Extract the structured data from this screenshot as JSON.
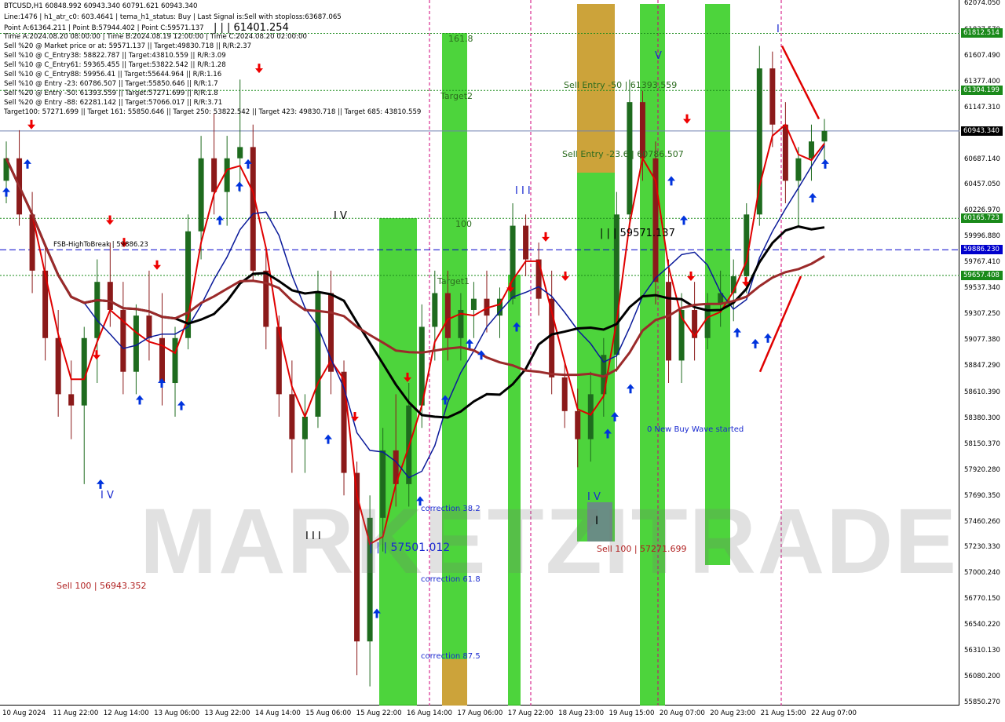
{
  "header": {
    "lines": [
      "BTCUSD,H1  60848.992 60943.340 60791.621 60943.340",
      "Line:1476  |  h1_atr_c0: 603.4641  |  tema_h1_status: Buy  |  Last Signal is:Sell with stoploss:63687.065",
      "Point A:61364.211  |  Point B:57944.402  |  Point C:59571.137",
      "Time A:2024.08.20 08:00:00  |  Time B:2024.08.19 12:00:00  |  Time C:2024.08.20 02:00:00",
      "Sell %20 @ Market price or at: 59571.137  ||  Target:49830.718  ||  R/R:2.37",
      "Sell %10 @ C_Entry38: 58822.787  ||  Target:43810.559  ||  R/R:3.09",
      "Sell %10 @ C_Entry61: 59365.455  ||  Target:53822.542  ||  R/R:1.28",
      "Sell %10 @ C_Entry88: 59956.41  ||  Target:55644.964  ||  R/R:1.16",
      "Sell %10 @ Entry -23: 60786.507  ||  Target:55850.646  ||  R/R:1.7",
      "Sell %20 @ Entry -50: 61393.559  ||  Target:57271.699  ||  R/R:1.8",
      "Sell %20 @ Entry -88: 62281.142  ||  Target:57066.017  ||  R/R:3.71",
      "Target100: 57271.699  ||  Target 161: 55850.646  ||  Target 250: 53822.542  ||  Target 423: 49830.718  ||  Target 685: 43810.559"
    ]
  },
  "colors": {
    "bull_candle": "#1e6b1e",
    "bear_candle": "#8b1a1a",
    "ma_red": "#e00000",
    "ma_blue": "#0a1a9a",
    "ma_black": "#000000",
    "ma_maroon": "#9b2a2a",
    "zone_green": "#2ecc1a",
    "zone_orange": "#e39a3a",
    "zone_gray": "#6f8090",
    "level_green": "#1a8a1a",
    "level_blue": "#0000cc",
    "current_price_line": "#7080b0",
    "buy_arrow": "#0033dd",
    "sell_arrow": "#ee0000"
  },
  "price_axis": {
    "ticks": [
      "62074.050",
      "61837.570",
      "61607.490",
      "61377.400",
      "61147.310",
      "60917.230",
      "60687.140",
      "60457.050",
      "60226.970",
      "59996.880",
      "59767.410",
      "59537.340",
      "59307.250",
      "59077.380",
      "58847.290",
      "58610.390",
      "58380.300",
      "58150.370",
      "57920.280",
      "57690.350",
      "57460.260",
      "57230.330",
      "57000.240",
      "56770.150",
      "56540.220",
      "56310.130",
      "56080.200",
      "55850.270"
    ],
    "badges": [
      {
        "text": "61812.514",
        "price": 61812.514,
        "color": "#1a8a1a"
      },
      {
        "text": "61304.199",
        "price": 61304.199,
        "color": "#1a8a1a"
      },
      {
        "text": "60943.340",
        "price": 60943.34,
        "color": "#000000"
      },
      {
        "text": "60165.723",
        "price": 60165.723,
        "color": "#1a8a1a"
      },
      {
        "text": "59886.230",
        "price": 59886.23,
        "color": "#0000cc"
      },
      {
        "text": "59657.408",
        "price": 59657.408,
        "color": "#1a8a1a"
      }
    ]
  },
  "time_axis": {
    "ticks": [
      "10 Aug 2024",
      "11 Aug 22:00",
      "12 Aug 14:00",
      "13 Aug 06:00",
      "13 Aug 22:00",
      "14 Aug 14:00",
      "15 Aug 06:00",
      "15 Aug 22:00",
      "16 Aug 14:00",
      "17 Aug 06:00",
      "17 Aug 22:00",
      "18 Aug 23:00",
      "19 Aug 15:00",
      "20 Aug 07:00",
      "20 Aug 23:00",
      "21 Aug 15:00",
      "22 Aug 07:00"
    ]
  },
  "annotations": {
    "price_label_1": "| | | 61401.254",
    "price_label_2": "| | | 59571.137",
    "price_label_3": "| | | 57501.012",
    "sell_entry_50": "Sell Entry -50 | 61393.559",
    "sell_entry_23": "Sell Entry -23.6 | 60786.507",
    "sell_100_right": "Sell 100 | 57271.699",
    "sell_100_left": "Sell 100 | 56943.352",
    "fsb_label": "FSB-HighToBreak | 59886.23",
    "fib_161": "161.8",
    "fib_target2": "Target2",
    "fib_100": "100",
    "fib_target1": "Target1",
    "correction_38": "correction 38.2",
    "correction_61": "correction 61.8",
    "correction_87": "correction 87.5",
    "new_wave": "0 New Buy Wave started",
    "wave_iv_1": "I V",
    "wave_iv_2": "I V",
    "wave_iv_3": "I V",
    "wave_iii_1": "I I I",
    "wave_iii_2": "I I I",
    "wave_v": "V",
    "wave_i_1": "I",
    "wave_i_2": "I",
    "watermark": "MARKETZITRADE"
  },
  "chart_data": {
    "type": "candlestick",
    "symbol": "BTCUSD,H1",
    "ylim": [
      55850.27,
      62074.05
    ],
    "series_note": "Candles estimated from chart image, approx. 66 hourly bars sampled across the visible range",
    "candles": [
      [
        60500,
        60850,
        60300,
        60700
      ],
      [
        60700,
        60950,
        60100,
        60200
      ],
      [
        60200,
        60400,
        59500,
        59700
      ],
      [
        59700,
        59900,
        58900,
        59100
      ],
      [
        59100,
        59350,
        58400,
        58600
      ],
      [
        58600,
        58900,
        58200,
        58500
      ],
      [
        58500,
        59200,
        57800,
        59100
      ],
      [
        59100,
        59800,
        58700,
        59600
      ],
      [
        59600,
        59950,
        59200,
        59350
      ],
      [
        59350,
        59600,
        58600,
        58800
      ],
      [
        58800,
        59400,
        58600,
        59300
      ],
      [
        59300,
        59700,
        58900,
        59100
      ],
      [
        59100,
        59500,
        58500,
        58700
      ],
      [
        58700,
        59200,
        58400,
        59100
      ],
      [
        59100,
        60200,
        59000,
        60050
      ],
      [
        60050,
        60900,
        59800,
        60700
      ],
      [
        60700,
        61100,
        60200,
        60400
      ],
      [
        60400,
        60900,
        60100,
        60700
      ],
      [
        60700,
        61401,
        60400,
        60800
      ],
      [
        60800,
        61000,
        59600,
        59700
      ],
      [
        59700,
        59900,
        59000,
        59200
      ],
      [
        59200,
        59300,
        58400,
        58600
      ],
      [
        58600,
        58900,
        57900,
        58200
      ],
      [
        58200,
        58600,
        57900,
        58400
      ],
      [
        58400,
        59700,
        58300,
        59500
      ],
      [
        59500,
        59700,
        58600,
        58800
      ],
      [
        58800,
        58900,
        57700,
        57900
      ],
      [
        57900,
        58000,
        56100,
        56400
      ],
      [
        56400,
        57700,
        56000,
        57500
      ],
      [
        57500,
        58300,
        57200,
        58100
      ],
      [
        58100,
        58600,
        57600,
        57800
      ],
      [
        57800,
        58700,
        57600,
        58500
      ],
      [
        58500,
        59400,
        58300,
        59200
      ],
      [
        59200,
        59700,
        58900,
        59500
      ],
      [
        59500,
        59700,
        58900,
        59100
      ],
      [
        59100,
        59500,
        58900,
        59350
      ],
      [
        59350,
        59600,
        59100,
        59450
      ],
      [
        59450,
        59700,
        59150,
        59300
      ],
      [
        59300,
        59550,
        59100,
        59450
      ],
      [
        59450,
        60300,
        59400,
        60100
      ],
      [
        60100,
        60200,
        59650,
        59800
      ],
      [
        59800,
        59950,
        59300,
        59450
      ],
      [
        59450,
        59700,
        58600,
        58750
      ],
      [
        58750,
        58900,
        58300,
        58450
      ],
      [
        58450,
        58650,
        57950,
        58200
      ],
      [
        58200,
        58800,
        58000,
        58600
      ],
      [
        58600,
        59100,
        58400,
        58950
      ],
      [
        58950,
        60400,
        58800,
        60200
      ],
      [
        60200,
        61400,
        60100,
        61200
      ],
      [
        61200,
        61300,
        60500,
        60700
      ],
      [
        60700,
        60850,
        59400,
        59600
      ],
      [
        59600,
        59800,
        58700,
        58900
      ],
      [
        58900,
        59500,
        58700,
        59350
      ],
      [
        59350,
        59600,
        58900,
        59100
      ],
      [
        59100,
        59500,
        59000,
        59400
      ],
      [
        59400,
        59700,
        59200,
        59500
      ],
      [
        59500,
        59800,
        59250,
        59650
      ],
      [
        59650,
        60300,
        59500,
        60200
      ],
      [
        60200,
        61700,
        60100,
        61500
      ],
      [
        61500,
        61650,
        60800,
        61000
      ],
      [
        61000,
        61200,
        60300,
        60500
      ],
      [
        60500,
        60800,
        60100,
        60700
      ],
      [
        60700,
        61000,
        60500,
        60850
      ],
      [
        60850,
        61050,
        60650,
        60943.34
      ]
    ]
  }
}
